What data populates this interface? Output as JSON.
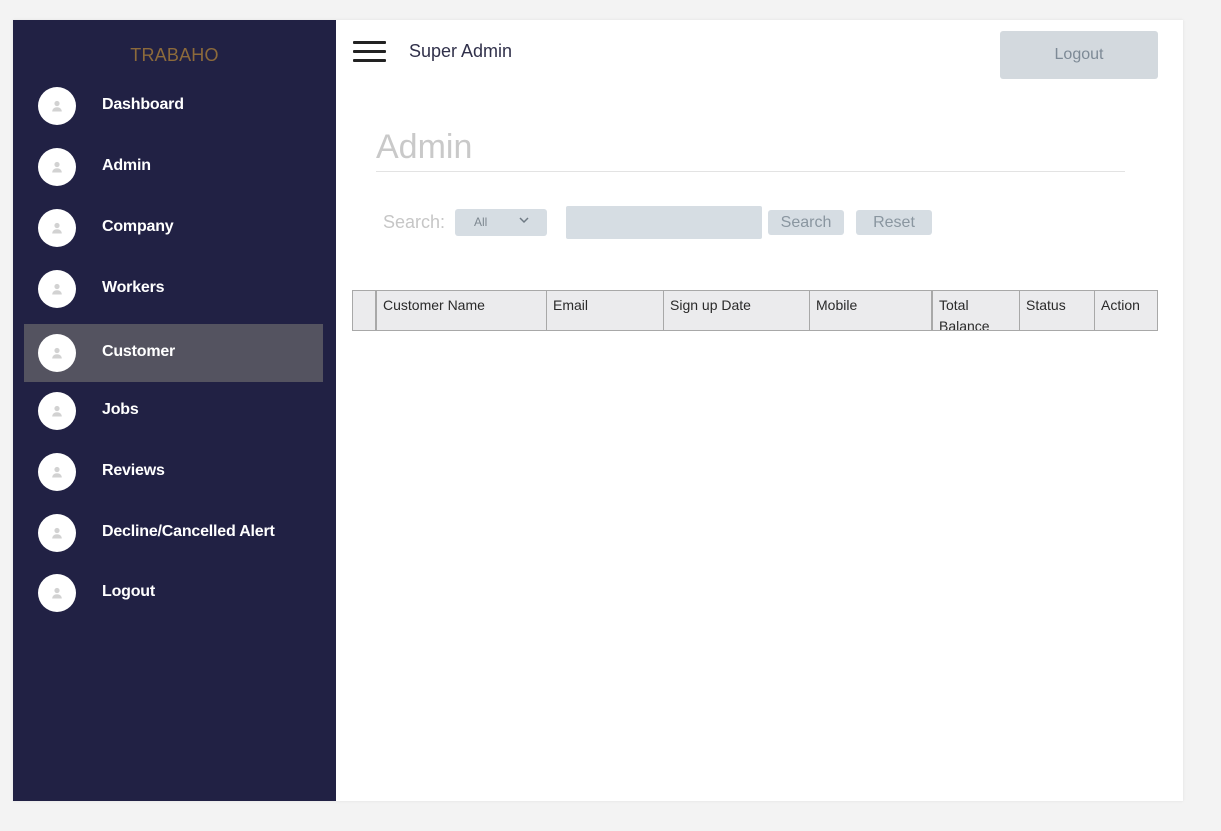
{
  "sidebar": {
    "brand": "TRABAHO",
    "items": [
      {
        "label": "Dashboard",
        "active": false
      },
      {
        "label": "Admin",
        "active": false
      },
      {
        "label": "Company",
        "active": false
      },
      {
        "label": "Workers",
        "active": false
      },
      {
        "label": "Customer",
        "active": true
      },
      {
        "label": "Jobs",
        "active": false
      },
      {
        "label": "Reviews",
        "active": false
      },
      {
        "label": "Decline/Cancelled Alert",
        "active": false
      },
      {
        "label": "Logout",
        "active": false
      }
    ]
  },
  "header": {
    "title": "Super Admin",
    "logout_label": "Logout",
    "menu_icon": "hamburger-menu-icon"
  },
  "main": {
    "page_title": "Admin",
    "search": {
      "label": "Search:",
      "filter_value": "All",
      "query": "",
      "search_button": "Search",
      "reset_button": "Reset"
    },
    "table": {
      "columns": [
        "",
        "Customer Name",
        "Email",
        "Sign up Date",
        "Mobile",
        "Total Balance",
        "Status",
        "Action"
      ],
      "rows": []
    }
  },
  "colors": {
    "sidebar_bg": "#212144",
    "sidebar_active": "#545360",
    "brand": "#8c6a3b",
    "control_bg": "#d6dde3"
  }
}
